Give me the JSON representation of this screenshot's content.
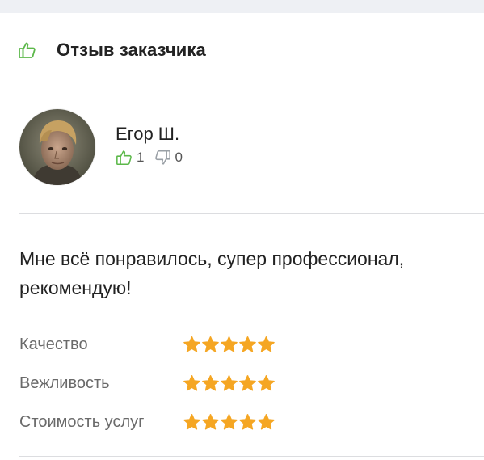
{
  "header": {
    "title": "Отзыв заказчика",
    "icon": "thumbs-up-icon",
    "icon_color": "#5cb84a"
  },
  "reviewer": {
    "name": "Егор Ш.",
    "avatar": "user-avatar-photo",
    "likes": "1",
    "dislikes": "0",
    "like_color": "#5cb84a",
    "dislike_color": "#9aa0a6"
  },
  "review": {
    "text": "Мне всё понравилось, супер профессионал, рекомендую!"
  },
  "ratings": [
    {
      "label": "Качество",
      "stars": 5,
      "max": 5
    },
    {
      "label": "Вежливость",
      "stars": 5,
      "max": 5
    },
    {
      "label": "Стоимость услуг",
      "stars": 5,
      "max": 5
    }
  ],
  "colors": {
    "star": "#f5a623",
    "divider": "#dcdde0",
    "band": "#eef0f4"
  }
}
